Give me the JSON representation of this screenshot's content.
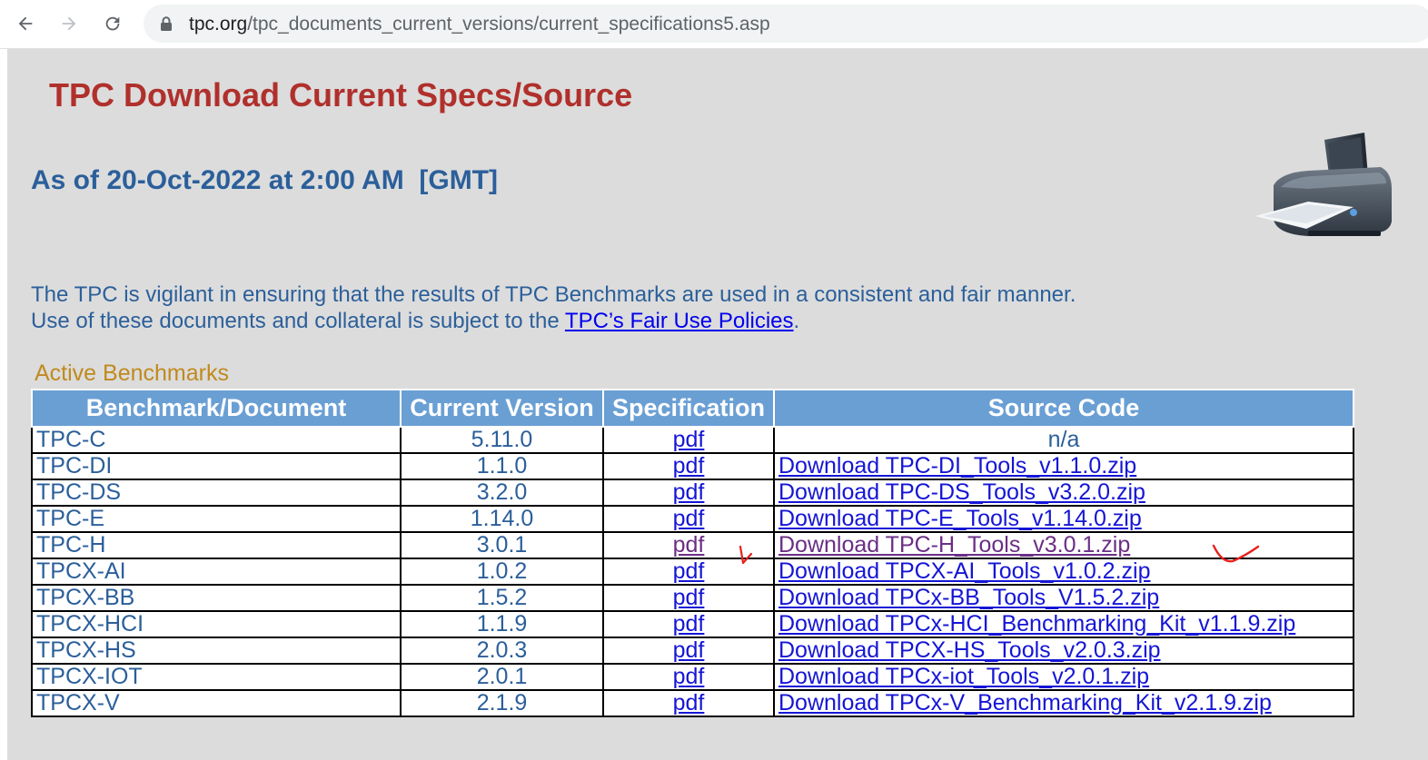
{
  "browser": {
    "url_domain": "tpc.org",
    "url_path": "/tpc_documents_current_versions/current_specifications5.asp"
  },
  "page": {
    "title": "TPC Download Current Specs/Source",
    "as_of": "As of 20-Oct-2022 at 2:00 AM  [GMT]",
    "intro_line1": "The TPC is vigilant in ensuring that the results of TPC Benchmarks are used in a consistent and fair manner.",
    "intro_line2_prefix": "Use of these documents and collateral is subject to the ",
    "intro_link": "TPC’s Fair Use Policies",
    "intro_line2_suffix": ".",
    "section_label": "Active Benchmarks"
  },
  "table": {
    "headers": {
      "benchmark": "Benchmark/Document",
      "version": "Current Version",
      "spec": "Specification",
      "source": "Source Code"
    },
    "rows": [
      {
        "name": "TPC-C",
        "version": "5.11.0",
        "spec": "pdf",
        "source": "n/a"
      },
      {
        "name": "TPC-DI",
        "version": "1.1.0",
        "spec": "pdf",
        "source": "Download TPC-DI_Tools_v1.1.0.zip"
      },
      {
        "name": "TPC-DS",
        "version": "3.2.0",
        "spec": "pdf",
        "source": "Download TPC-DS_Tools_v3.2.0.zip"
      },
      {
        "name": "TPC-E",
        "version": "1.14.0",
        "spec": "pdf",
        "source": "Download TPC-E_Tools_v1.14.0.zip"
      },
      {
        "name": "TPC-H",
        "version": "3.0.1",
        "spec": "pdf",
        "source": "Download TPC-H_Tools_v3.0.1.zip"
      },
      {
        "name": "TPCX-AI",
        "version": "1.0.2",
        "spec": "pdf",
        "source": "Download TPCX-AI_Tools_v1.0.2.zip"
      },
      {
        "name": "TPCX-BB",
        "version": "1.5.2",
        "spec": "pdf",
        "source": "Download TPCx-BB_Tools_V1.5.2.zip"
      },
      {
        "name": "TPCX-HCI",
        "version": "1.1.9",
        "spec": "pdf",
        "source": "Download TPCx-HCI_Benchmarking_Kit_v1.1.9.zip"
      },
      {
        "name": "TPCX-HS",
        "version": "2.0.3",
        "spec": "pdf",
        "source": "Download TPCX-HS_Tools_v2.0.3.zip"
      },
      {
        "name": "TPCX-IOT",
        "version": "2.0.1",
        "spec": "pdf",
        "source": "Download TPCx-iot_Tools_v2.0.1.zip"
      },
      {
        "name": "TPCX-V",
        "version": "2.1.9",
        "spec": "pdf",
        "source": "Download TPCx-V_Benchmarking_Kit_v2.1.9.zip"
      }
    ]
  },
  "colors": {
    "title": "#b0302c",
    "text_blue": "#2b5f9a",
    "header_bg": "#6a9fd4",
    "link": "#1515d6",
    "visited_link": "#6b2e86",
    "annotation": "#e8201c"
  }
}
